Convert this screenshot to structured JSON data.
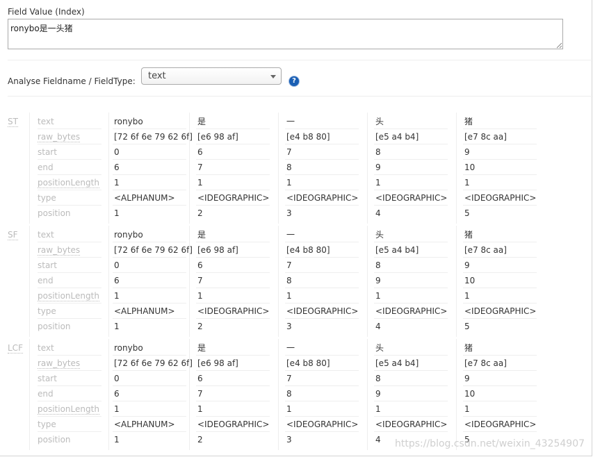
{
  "field_value": {
    "label": "Field Value (Index)",
    "value": "ronybo是一头猪"
  },
  "analyse": {
    "label": "Analyse Fieldname / FieldType:",
    "selected": "text",
    "help_glyph": "?"
  },
  "attributes": [
    "text",
    "raw_bytes",
    "start",
    "end",
    "positionLength",
    "type",
    "position"
  ],
  "blocks": [
    {
      "abbr": "ST",
      "tokens": [
        {
          "text": "ronybo",
          "raw_bytes": "[72 6f 6e 79 62 6f]",
          "start": "0",
          "end": "6",
          "positionLength": "1",
          "type": "<ALPHANUM>",
          "position": "1"
        },
        {
          "text": "是",
          "raw_bytes": "[e6 98 af]",
          "start": "6",
          "end": "7",
          "positionLength": "1",
          "type": "<IDEOGRAPHIC>",
          "position": "2"
        },
        {
          "text": "一",
          "raw_bytes": "[e4 b8 80]",
          "start": "7",
          "end": "8",
          "positionLength": "1",
          "type": "<IDEOGRAPHIC>",
          "position": "3"
        },
        {
          "text": "头",
          "raw_bytes": "[e5 a4 b4]",
          "start": "8",
          "end": "9",
          "positionLength": "1",
          "type": "<IDEOGRAPHIC>",
          "position": "4"
        },
        {
          "text": "猪",
          "raw_bytes": "[e7 8c aa]",
          "start": "9",
          "end": "10",
          "positionLength": "1",
          "type": "<IDEOGRAPHIC>",
          "position": "5"
        }
      ]
    },
    {
      "abbr": "SF",
      "tokens": [
        {
          "text": "ronybo",
          "raw_bytes": "[72 6f 6e 79 62 6f]",
          "start": "0",
          "end": "6",
          "positionLength": "1",
          "type": "<ALPHANUM>",
          "position": "1"
        },
        {
          "text": "是",
          "raw_bytes": "[e6 98 af]",
          "start": "6",
          "end": "7",
          "positionLength": "1",
          "type": "<IDEOGRAPHIC>",
          "position": "2"
        },
        {
          "text": "一",
          "raw_bytes": "[e4 b8 80]",
          "start": "7",
          "end": "8",
          "positionLength": "1",
          "type": "<IDEOGRAPHIC>",
          "position": "3"
        },
        {
          "text": "头",
          "raw_bytes": "[e5 a4 b4]",
          "start": "8",
          "end": "9",
          "positionLength": "1",
          "type": "<IDEOGRAPHIC>",
          "position": "4"
        },
        {
          "text": "猪",
          "raw_bytes": "[e7 8c aa]",
          "start": "9",
          "end": "10",
          "positionLength": "1",
          "type": "<IDEOGRAPHIC>",
          "position": "5"
        }
      ]
    },
    {
      "abbr": "LCF",
      "tokens": [
        {
          "text": "ronybo",
          "raw_bytes": "[72 6f 6e 79 62 6f]",
          "start": "0",
          "end": "6",
          "positionLength": "1",
          "type": "<ALPHANUM>",
          "position": "1"
        },
        {
          "text": "是",
          "raw_bytes": "[e6 98 af]",
          "start": "6",
          "end": "7",
          "positionLength": "1",
          "type": "<IDEOGRAPHIC>",
          "position": "2"
        },
        {
          "text": "一",
          "raw_bytes": "[e4 b8 80]",
          "start": "7",
          "end": "8",
          "positionLength": "1",
          "type": "<IDEOGRAPHIC>",
          "position": "3"
        },
        {
          "text": "头",
          "raw_bytes": "[e5 a4 b4]",
          "start": "8",
          "end": "9",
          "positionLength": "1",
          "type": "<IDEOGRAPHIC>",
          "position": "4"
        },
        {
          "text": "猪",
          "raw_bytes": "[e7 8c aa]",
          "start": "9",
          "end": "10",
          "positionLength": "1",
          "type": "<IDEOGRAPHIC>",
          "position": "5"
        }
      ]
    }
  ],
  "watermark": "https://blog.csdn.net/weixin_43254907"
}
